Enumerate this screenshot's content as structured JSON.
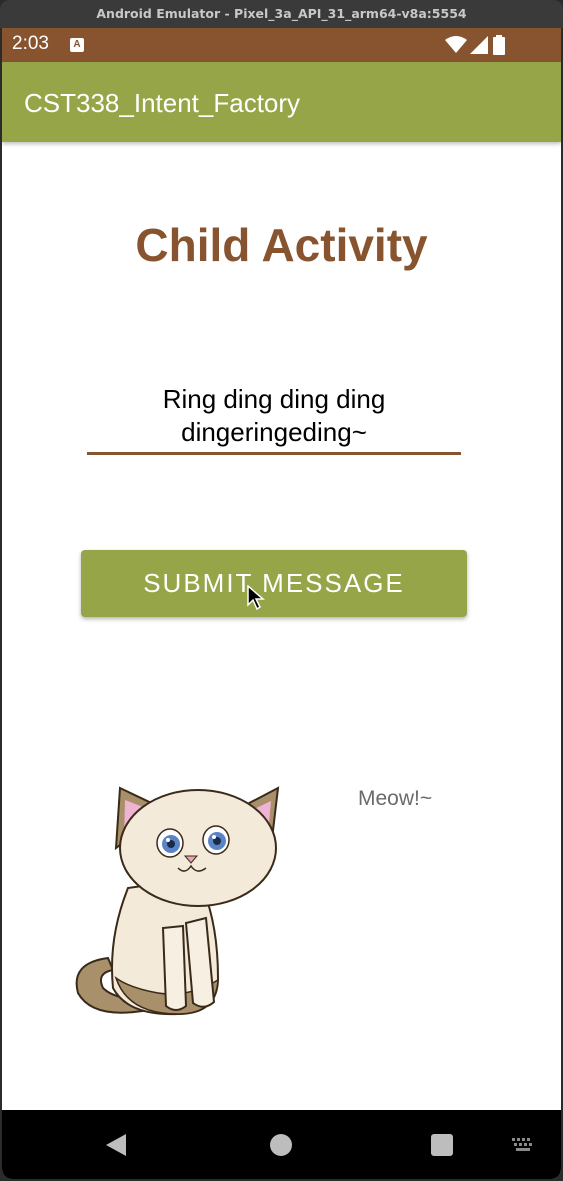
{
  "emulator": {
    "title": "Android Emulator - Pixel_3a_API_31_arm64-v8a:5554"
  },
  "status_bar": {
    "time": "2:03",
    "notification_icon": "A",
    "icons": [
      "wifi-icon",
      "signal-icon",
      "battery-icon"
    ],
    "color": "#87542f"
  },
  "app_bar": {
    "title": "CST338_Intent_Factory",
    "color": "#95a548"
  },
  "content": {
    "heading": "Child Activity",
    "message_value": "Ring ding ding ding dingeringeding~",
    "submit_label": "SUBMIT MESSAGE",
    "meow_text": "Meow!~"
  },
  "nav_bar": {
    "icons": [
      "back-icon",
      "home-icon",
      "recents-icon",
      "keyboard-icon"
    ]
  },
  "colors": {
    "heading": "#87542f",
    "button": "#95a548",
    "underline": "#87542f"
  }
}
